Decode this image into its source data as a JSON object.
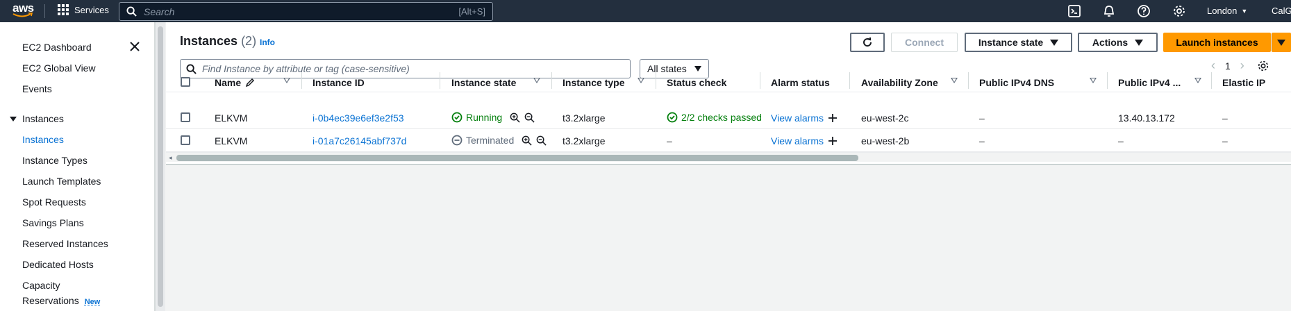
{
  "topnav": {
    "logo_text": "aws",
    "services_label": "Services",
    "search_placeholder": "Search",
    "search_shortcut": "[Alt+S]",
    "region_label": "London",
    "account_label": "CalG"
  },
  "sidebar": {
    "items_top": [
      "EC2 Dashboard",
      "EC2 Global View",
      "Events"
    ],
    "section_label": "Instances",
    "section_items": [
      "Instances",
      "Instance Types",
      "Launch Templates",
      "Spot Requests",
      "Savings Plans",
      "Reserved Instances",
      "Dedicated Hosts",
      "Capacity",
      "Reservations"
    ],
    "new_badge": "New",
    "active_item": "Instances"
  },
  "main": {
    "title": "Instances",
    "count": "(2)",
    "info_label": "Info",
    "buttons": {
      "connect": "Connect",
      "instance_state": "Instance state",
      "actions": "Actions",
      "launch": "Launch instances"
    },
    "filter_placeholder": "Find Instance by attribute or tag (case-sensitive)",
    "states_filter": "All states",
    "page_number": "1"
  },
  "table": {
    "columns": [
      "Name",
      "Instance ID",
      "Instance state",
      "Instance type",
      "Status check",
      "Alarm status",
      "Availability Zone",
      "Public IPv4 DNS",
      "Public IPv4 ...",
      "Elastic IP"
    ],
    "rows": [
      {
        "name": "ELKVM",
        "instance_id": "i-0b4ec39e6ef3e2f53",
        "state": "Running",
        "type": "t3.2xlarge",
        "status_check": "2/2 checks passed",
        "alarm": "View alarms",
        "az": "eu-west-2c",
        "dns": "–",
        "ipv4": "13.40.13.172",
        "eip": "–"
      },
      {
        "name": "ELKVM",
        "instance_id": "i-01a7c26145abf737d",
        "state": "Terminated",
        "type": "t3.2xlarge",
        "status_check": "–",
        "alarm": "View alarms",
        "az": "eu-west-2b",
        "dns": "–",
        "ipv4": "–",
        "eip": "–"
      }
    ]
  },
  "colors": {
    "nav_bg": "#232f3e",
    "link": "#0972d3",
    "success": "#037f0c",
    "primary": "#ff9900"
  }
}
